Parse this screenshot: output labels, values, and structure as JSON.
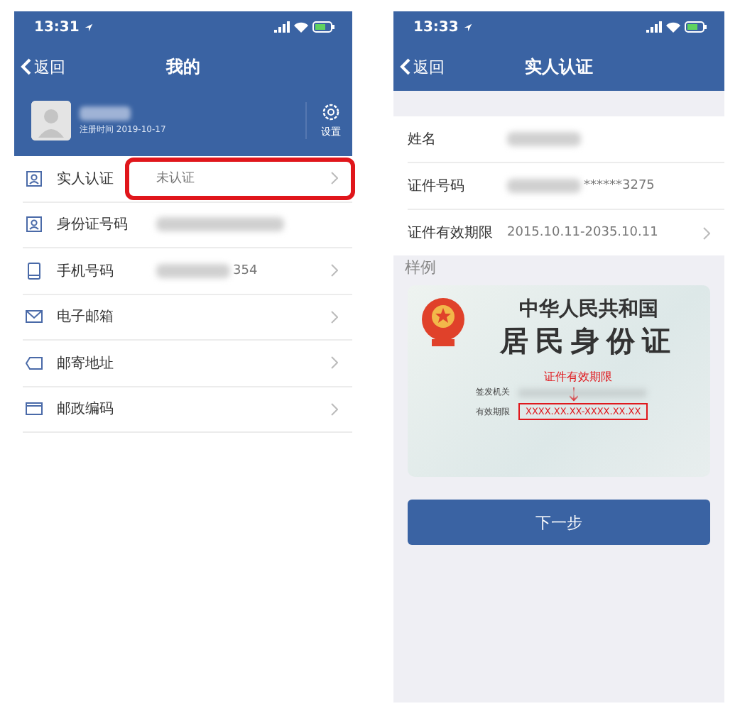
{
  "left_screen": {
    "status_bar": {
      "time": "13:31"
    },
    "nav": {
      "back": "返回",
      "title": "我的"
    },
    "profile": {
      "registered": "注册时间 2019-10-17",
      "settings": "设置",
      "name_blurred": true
    },
    "rows": [
      {
        "kind": "id",
        "label": "实人认证",
        "value": "未认证",
        "blurred": false,
        "chevron": true,
        "highlighted": true
      },
      {
        "kind": "id",
        "label": "身份证号码",
        "blurred": true,
        "chevron": false,
        "highlighted": false
      },
      {
        "kind": "phone",
        "label": "手机号码",
        "value": "354",
        "blurred": true,
        "chevron": true,
        "highlighted": false
      },
      {
        "kind": "mail",
        "label": "电子邮箱",
        "blurred": false,
        "chevron": true,
        "highlighted": false
      },
      {
        "kind": "address",
        "label": "邮寄地址",
        "blurred": false,
        "chevron": true,
        "highlighted": false
      },
      {
        "kind": "postcode",
        "label": "邮政编码",
        "blurred": false,
        "chevron": true,
        "highlighted": false
      }
    ]
  },
  "right_screen": {
    "status_bar": {
      "time": "13:33"
    },
    "nav": {
      "back": "返回",
      "title": "实人认证"
    },
    "fields": [
      {
        "label": "姓名",
        "blurred": true,
        "chevron": false
      },
      {
        "label": "证件号码",
        "value": "******3275",
        "blurred": true,
        "chevron": false
      },
      {
        "label": "证件有效期限",
        "value": "2015.10.11-2035.10.11",
        "blurred": false,
        "chevron": true
      }
    ],
    "sample": {
      "heading": "样例",
      "country": "中华人民共和国",
      "card_title": "居民身份证",
      "callout": "证件有效期限",
      "issuer_label": "签发机关",
      "validity_label": "有效期限",
      "validity_value": "XXXX.XX.XX-XXXX.XX.XX"
    },
    "button": "下一步"
  }
}
